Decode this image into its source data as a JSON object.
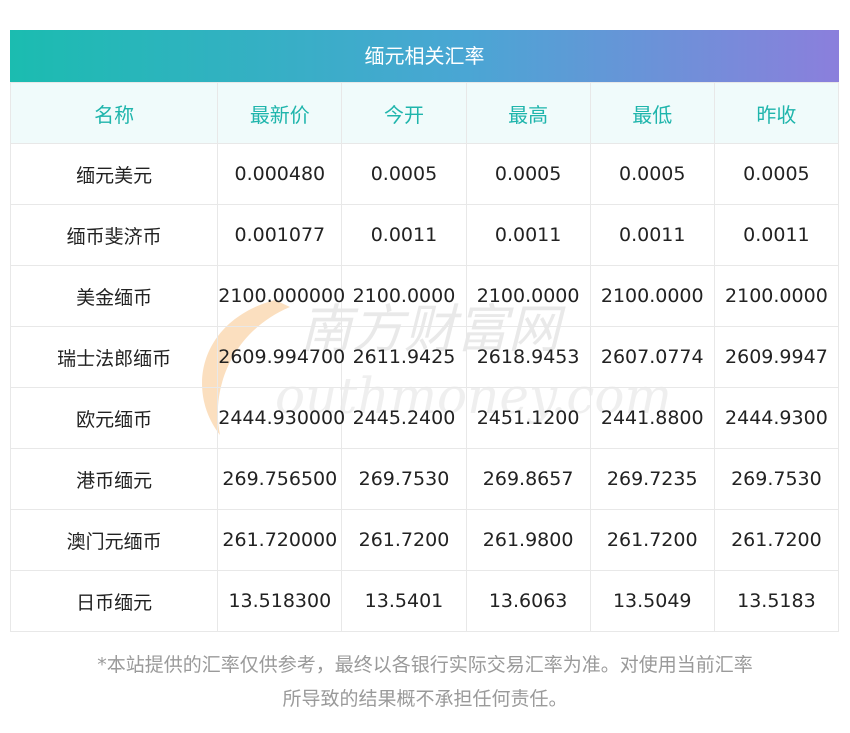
{
  "title": "缅元相关汇率",
  "headers": [
    "名称",
    "最新价",
    "今开",
    "最高",
    "最低",
    "昨收"
  ],
  "rows": [
    [
      "缅元美元",
      "0.000480",
      "0.0005",
      "0.0005",
      "0.0005",
      "0.0005"
    ],
    [
      "缅币斐济币",
      "0.001077",
      "0.0011",
      "0.0011",
      "0.0011",
      "0.0011"
    ],
    [
      "美金缅币",
      "2100.000000",
      "2100.0000",
      "2100.0000",
      "2100.0000",
      "2100.0000"
    ],
    [
      "瑞士法郎缅币",
      "2609.994700",
      "2611.9425",
      "2618.9453",
      "2607.0774",
      "2609.9947"
    ],
    [
      "欧元缅币",
      "2444.930000",
      "2445.2400",
      "2451.1200",
      "2441.8800",
      "2444.9300"
    ],
    [
      "港币缅元",
      "269.756500",
      "269.7530",
      "269.8657",
      "269.7235",
      "269.7530"
    ],
    [
      "澳门元缅币",
      "261.720000",
      "261.7200",
      "261.9800",
      "261.7200",
      "261.7200"
    ],
    [
      "日币缅元",
      "13.518300",
      "13.5401",
      "13.6063",
      "13.5049",
      "13.5183"
    ]
  ],
  "watermark": {
    "text_cn": "南方财富网",
    "text_en": "outhmoney.com"
  },
  "disclaimer": {
    "line1": "*本站提供的汇率仅供参考，最终以各银行实际交易汇率为准。对使用当前汇率",
    "line2": "所导致的结果概不承担任何责任。"
  },
  "colors": {
    "accent": "#1fb5ac",
    "gradient_start": "#1bbcb0",
    "gradient_end": "#8b7fdc",
    "header_bg": "#f0fbfb"
  }
}
